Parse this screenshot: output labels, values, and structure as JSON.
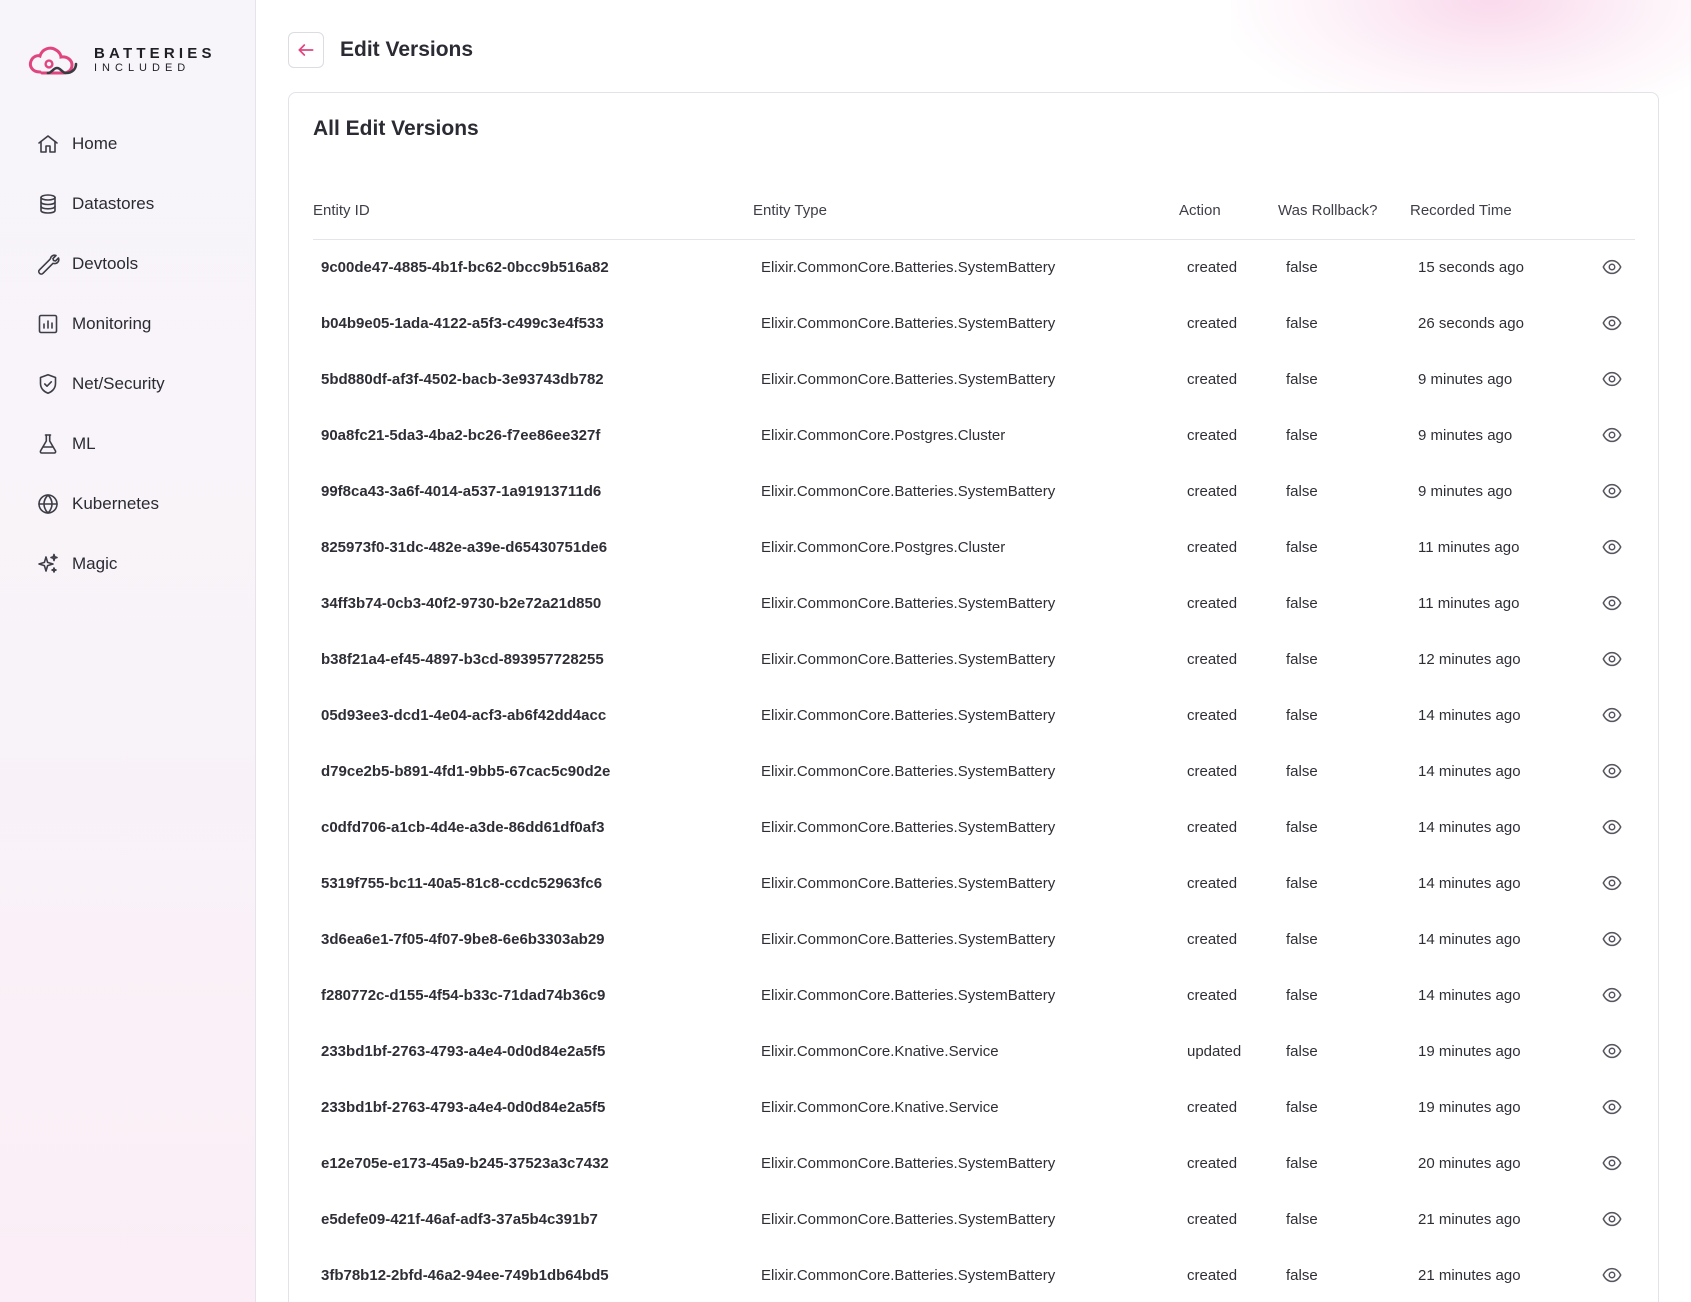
{
  "brand": {
    "name": "BATTERIES",
    "sub": "INCLUDED",
    "accent": "#e0457f"
  },
  "sidebar": {
    "items": [
      {
        "label": "Home",
        "icon": "home-icon"
      },
      {
        "label": "Datastores",
        "icon": "database-icon"
      },
      {
        "label": "Devtools",
        "icon": "wrench-icon"
      },
      {
        "label": "Monitoring",
        "icon": "chart-icon"
      },
      {
        "label": "Net/Security",
        "icon": "shield-icon"
      },
      {
        "label": "ML",
        "icon": "flask-icon"
      },
      {
        "label": "Kubernetes",
        "icon": "globe-icon"
      },
      {
        "label": "Magic",
        "icon": "sparkles-icon"
      }
    ]
  },
  "header": {
    "title": "Edit Versions",
    "back_icon": "arrow-left-icon"
  },
  "card": {
    "title": "All Edit Versions"
  },
  "table": {
    "columns": [
      "Entity ID",
      "Entity Type",
      "Action",
      "Was Rollback?",
      "Recorded Time"
    ],
    "rows": [
      {
        "id": "9c00de47-4885-4b1f-bc62-0bcc9b516a82",
        "type": "Elixir.CommonCore.Batteries.SystemBattery",
        "action": "created",
        "rollback": "false",
        "time": "15 seconds ago"
      },
      {
        "id": "b04b9e05-1ada-4122-a5f3-c499c3e4f533",
        "type": "Elixir.CommonCore.Batteries.SystemBattery",
        "action": "created",
        "rollback": "false",
        "time": "26 seconds ago"
      },
      {
        "id": "5bd880df-af3f-4502-bacb-3e93743db782",
        "type": "Elixir.CommonCore.Batteries.SystemBattery",
        "action": "created",
        "rollback": "false",
        "time": "9 minutes ago"
      },
      {
        "id": "90a8fc21-5da3-4ba2-bc26-f7ee86ee327f",
        "type": "Elixir.CommonCore.Postgres.Cluster",
        "action": "created",
        "rollback": "false",
        "time": "9 minutes ago"
      },
      {
        "id": "99f8ca43-3a6f-4014-a537-1a91913711d6",
        "type": "Elixir.CommonCore.Batteries.SystemBattery",
        "action": "created",
        "rollback": "false",
        "time": "9 minutes ago"
      },
      {
        "id": "825973f0-31dc-482e-a39e-d65430751de6",
        "type": "Elixir.CommonCore.Postgres.Cluster",
        "action": "created",
        "rollback": "false",
        "time": "11 minutes ago"
      },
      {
        "id": "34ff3b74-0cb3-40f2-9730-b2e72a21d850",
        "type": "Elixir.CommonCore.Batteries.SystemBattery",
        "action": "created",
        "rollback": "false",
        "time": "11 minutes ago"
      },
      {
        "id": "b38f21a4-ef45-4897-b3cd-893957728255",
        "type": "Elixir.CommonCore.Batteries.SystemBattery",
        "action": "created",
        "rollback": "false",
        "time": "12 minutes ago"
      },
      {
        "id": "05d93ee3-dcd1-4e04-acf3-ab6f42dd4acc",
        "type": "Elixir.CommonCore.Batteries.SystemBattery",
        "action": "created",
        "rollback": "false",
        "time": "14 minutes ago"
      },
      {
        "id": "d79ce2b5-b891-4fd1-9bb5-67cac5c90d2e",
        "type": "Elixir.CommonCore.Batteries.SystemBattery",
        "action": "created",
        "rollback": "false",
        "time": "14 minutes ago"
      },
      {
        "id": "c0dfd706-a1cb-4d4e-a3de-86dd61df0af3",
        "type": "Elixir.CommonCore.Batteries.SystemBattery",
        "action": "created",
        "rollback": "false",
        "time": "14 minutes ago"
      },
      {
        "id": "5319f755-bc11-40a5-81c8-ccdc52963fc6",
        "type": "Elixir.CommonCore.Batteries.SystemBattery",
        "action": "created",
        "rollback": "false",
        "time": "14 minutes ago"
      },
      {
        "id": "3d6ea6e1-7f05-4f07-9be8-6e6b3303ab29",
        "type": "Elixir.CommonCore.Batteries.SystemBattery",
        "action": "created",
        "rollback": "false",
        "time": "14 minutes ago"
      },
      {
        "id": "f280772c-d155-4f54-b33c-71dad74b36c9",
        "type": "Elixir.CommonCore.Batteries.SystemBattery",
        "action": "created",
        "rollback": "false",
        "time": "14 minutes ago"
      },
      {
        "id": "233bd1bf-2763-4793-a4e4-0d0d84e2a5f5",
        "type": "Elixir.CommonCore.Knative.Service",
        "action": "updated",
        "rollback": "false",
        "time": "19 minutes ago"
      },
      {
        "id": "233bd1bf-2763-4793-a4e4-0d0d84e2a5f5",
        "type": "Elixir.CommonCore.Knative.Service",
        "action": "created",
        "rollback": "false",
        "time": "19 minutes ago"
      },
      {
        "id": "e12e705e-e173-45a9-b245-37523a3c7432",
        "type": "Elixir.CommonCore.Batteries.SystemBattery",
        "action": "created",
        "rollback": "false",
        "time": "20 minutes ago"
      },
      {
        "id": "e5defe09-421f-46af-adf3-37a5b4c391b7",
        "type": "Elixir.CommonCore.Batteries.SystemBattery",
        "action": "created",
        "rollback": "false",
        "time": "21 minutes ago"
      },
      {
        "id": "3fb78b12-2bfd-46a2-94ee-749b1db64bd5",
        "type": "Elixir.CommonCore.Batteries.SystemBattery",
        "action": "created",
        "rollback": "false",
        "time": "21 minutes ago"
      }
    ],
    "row_action_icon": "eye-icon"
  }
}
